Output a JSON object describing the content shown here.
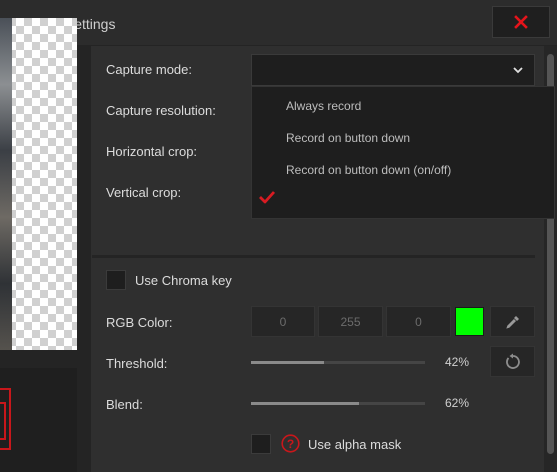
{
  "window": {
    "title": "Webcam Settings"
  },
  "colors": {
    "accent_red": "#c8171b",
    "chroma_color": "#00ff00",
    "menu_text": "#bdbdbd"
  },
  "capture": {
    "mode_label": "Capture mode:",
    "mode_value": "",
    "resolution_label": "Capture resolution:",
    "hcrop_label": "Horizontal crop:",
    "vcrop_label": "Vertical crop:",
    "menu_options": [
      "Always record",
      "Record on button down",
      "Record on button down (on/off)",
      ""
    ]
  },
  "chroma": {
    "use_label": "Use Chroma key",
    "use_checked": false,
    "rgb_label": "RGB Color:",
    "r": "0",
    "g": "255",
    "b": "0",
    "threshold_label": "Threshold:",
    "threshold": "42%",
    "threshold_fraction": 0.42,
    "blend_label": "Blend:",
    "blend": "62%",
    "blend_fraction": 0.62,
    "alpha_mask_label": "Use alpha mask",
    "alpha_mask_checked": false
  },
  "icons": {
    "close": "close-icon",
    "dropdown": "chevron-down-icon",
    "check": "checkmark-icon",
    "eyedropper": "eyedropper-icon",
    "reset": "reset-icon",
    "help": "help-icon"
  }
}
